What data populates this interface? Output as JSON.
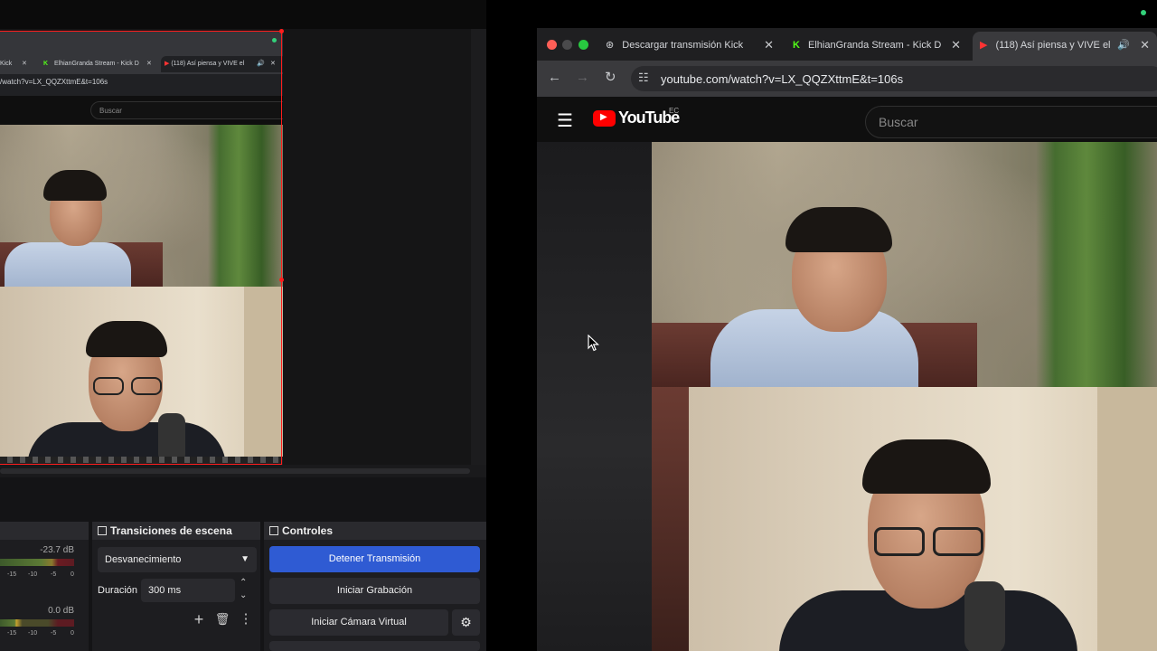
{
  "obs": {
    "preview": {
      "tabs": [
        "Kick",
        "ElhianGranda Stream - Kick D",
        "(118) Así piensa y VIVE el"
      ],
      "url": "/watch?v=LX_QQZXttmE&t=106s",
      "search_placeholder": "Buscar"
    },
    "audio": {
      "channels": [
        {
          "db": "-23.7 dB",
          "ticks": [
            "-15",
            "-10",
            "-5",
            "0"
          ]
        },
        {
          "db": "0.0 dB",
          "ticks": [
            "-15",
            "-10",
            "-5",
            "0"
          ]
        }
      ]
    },
    "transitions": {
      "title": "Transiciones de escena",
      "selected": "Desvanecimiento",
      "duration_label": "Duración",
      "duration_value": "300 ms"
    },
    "controls": {
      "title": "Controles",
      "stop_stream": "Detener Transmisión",
      "start_recording": "Iniciar Grabación",
      "start_virtual_cam": "Iniciar Cámara Virtual"
    }
  },
  "browser": {
    "tabs": [
      {
        "title": "Descargar transmisión Kick",
        "icon": "openai-icon"
      },
      {
        "title": "ElhianGranda Stream - Kick D",
        "icon": "kick-icon"
      },
      {
        "title": "(118) Así piensa y VIVE el",
        "icon": "youtube-icon"
      }
    ],
    "url": "youtube.com/watch?v=LX_QQZXttmE&t=106s",
    "youtube": {
      "logo_text": "YouTube",
      "country": "EC",
      "search_placeholder": "Buscar"
    }
  },
  "colors": {
    "obs_primary": "#2f5bd3",
    "preview_border": "#ff1d1d",
    "youtube_red": "#ff0000",
    "kick_green": "#53fc18"
  }
}
